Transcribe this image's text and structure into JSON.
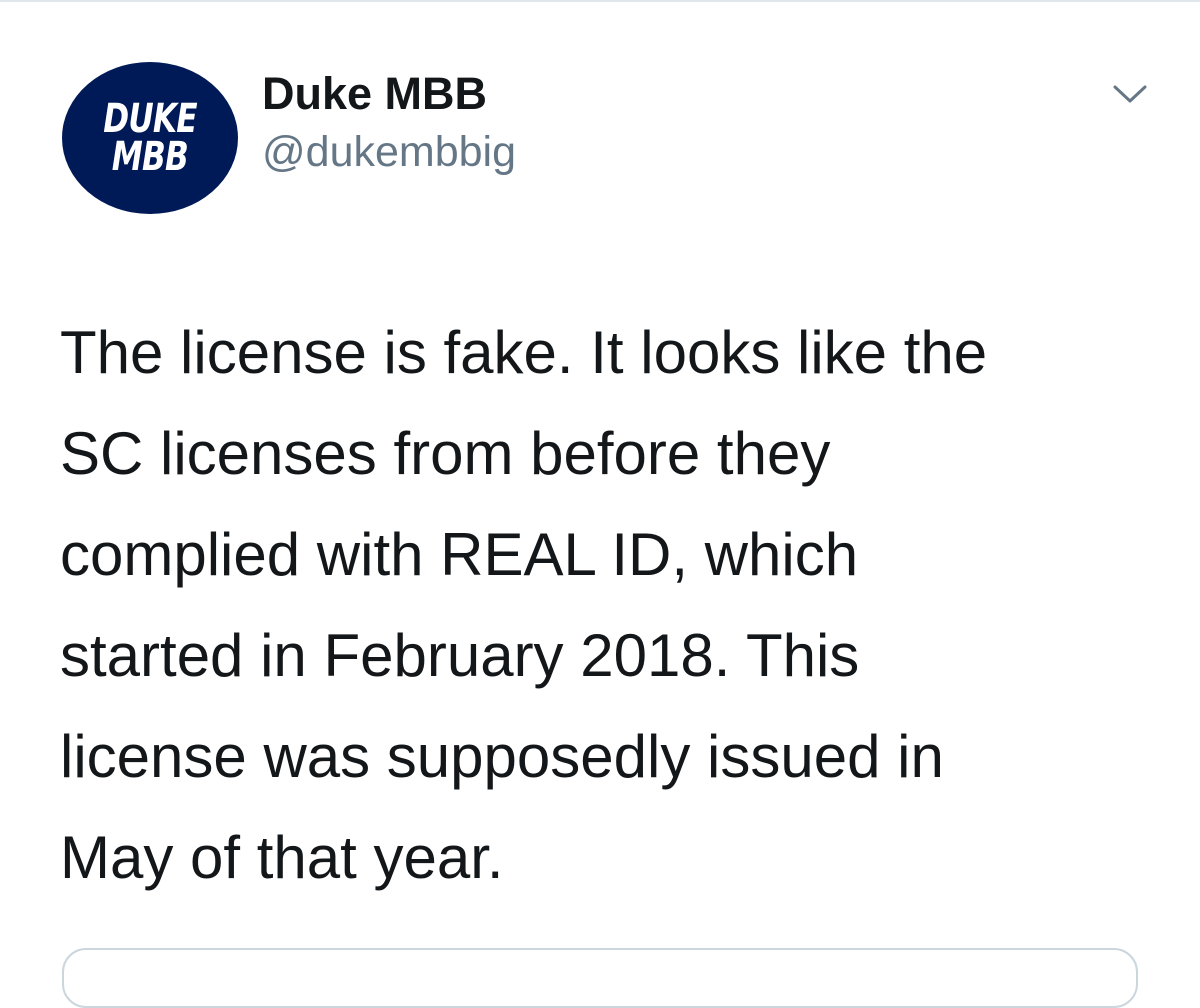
{
  "tweet": {
    "author": {
      "avatar_text_line1": "DUKE",
      "avatar_text_line2": "MBB",
      "display_name": "Duke MBB",
      "handle": "@dukembbig"
    },
    "menu_icon": "chevron-down-icon",
    "text": "The license is fake. It looks like the\nSC licenses from before they\ncomplied with REAL ID, which\nstarted in February 2018. This\nlicense was supposedly issued in\nMay of that year."
  },
  "colors": {
    "avatar_background": "#001a57",
    "avatar_text": "#ffffff",
    "name_text": "#14171a",
    "handle_text": "#657786",
    "divider": "#e1e8ed",
    "chevron": "#657786",
    "card_border": "#ccd6dd"
  }
}
